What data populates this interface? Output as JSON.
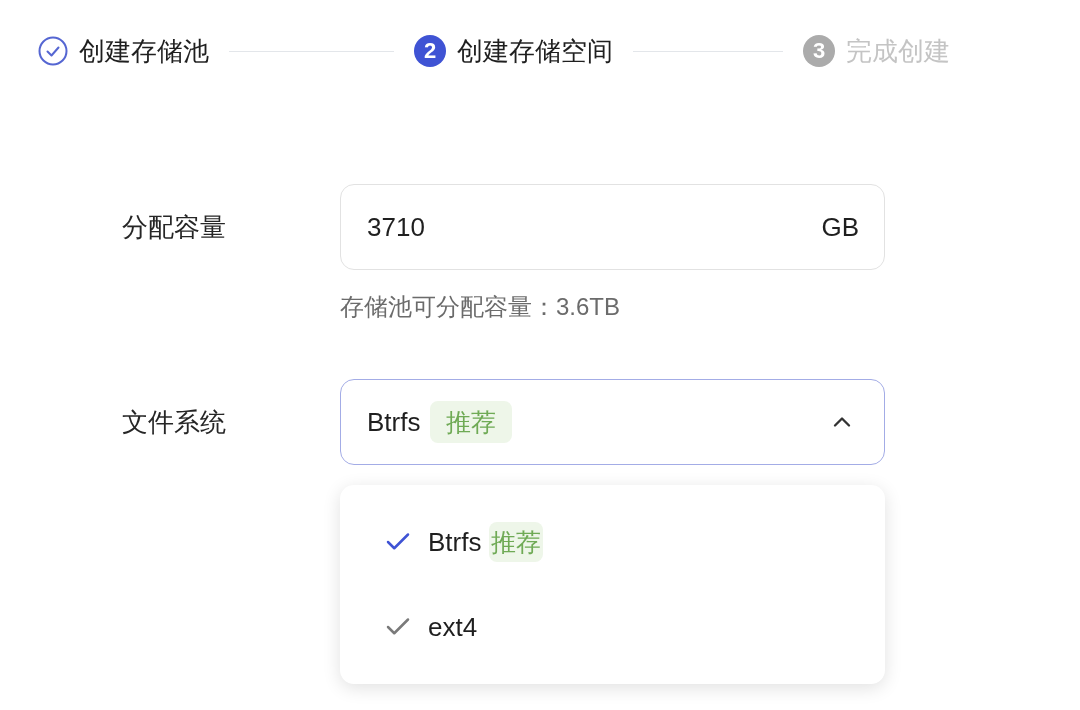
{
  "steps": [
    {
      "label": "创建存储池",
      "kind": "done"
    },
    {
      "number": "2",
      "label": "创建存储空间",
      "kind": "active"
    },
    {
      "number": "3",
      "label": "完成创建",
      "kind": "pending"
    }
  ],
  "form": {
    "capacity": {
      "label": "分配容量",
      "value": "3710",
      "unit": "GB",
      "hint": "存储池可分配容量：3.6TB"
    },
    "filesystem": {
      "label": "文件系统",
      "value": "Btrfs",
      "tag": "推荐",
      "expanded": true,
      "options": [
        {
          "label": "Btrfs",
          "tag": "推荐",
          "selected": true
        },
        {
          "label": "ext4",
          "selected": false
        }
      ]
    }
  }
}
